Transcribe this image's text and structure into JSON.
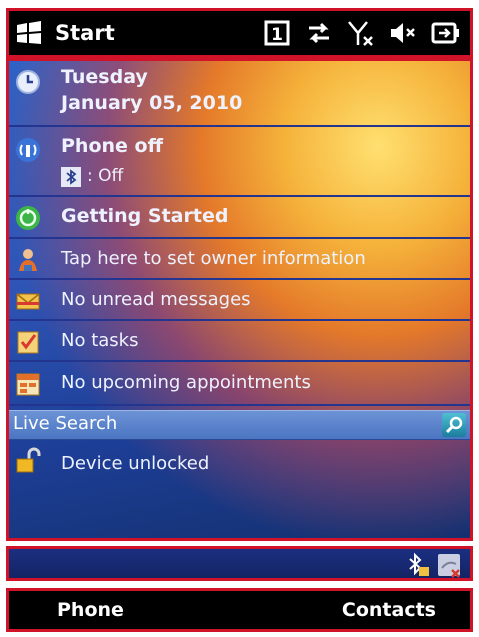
{
  "titlebar": {
    "start_label": "Start",
    "status_icons": [
      "line-1-icon",
      "data-connection-icon",
      "no-signal-icon",
      "volume-muted-icon",
      "battery-icon"
    ],
    "line_number": "1"
  },
  "today": {
    "date": {
      "day": "Tuesday",
      "full_date": "January 05, 2010"
    },
    "phone": {
      "status": "Phone off",
      "bluetooth_status": ": Off"
    },
    "getting_started": "Getting Started",
    "owner_info": "Tap here to set owner information",
    "messages": "No unread messages",
    "tasks": "No tasks",
    "appointments": "No upcoming appointments",
    "search": {
      "label": "Live Search"
    },
    "device_lock": "Device unlocked"
  },
  "softkeys": {
    "left": "Phone",
    "right": "Contacts"
  },
  "colors": {
    "highlight_border": "#d1132a",
    "row_divider": "#23358f"
  }
}
